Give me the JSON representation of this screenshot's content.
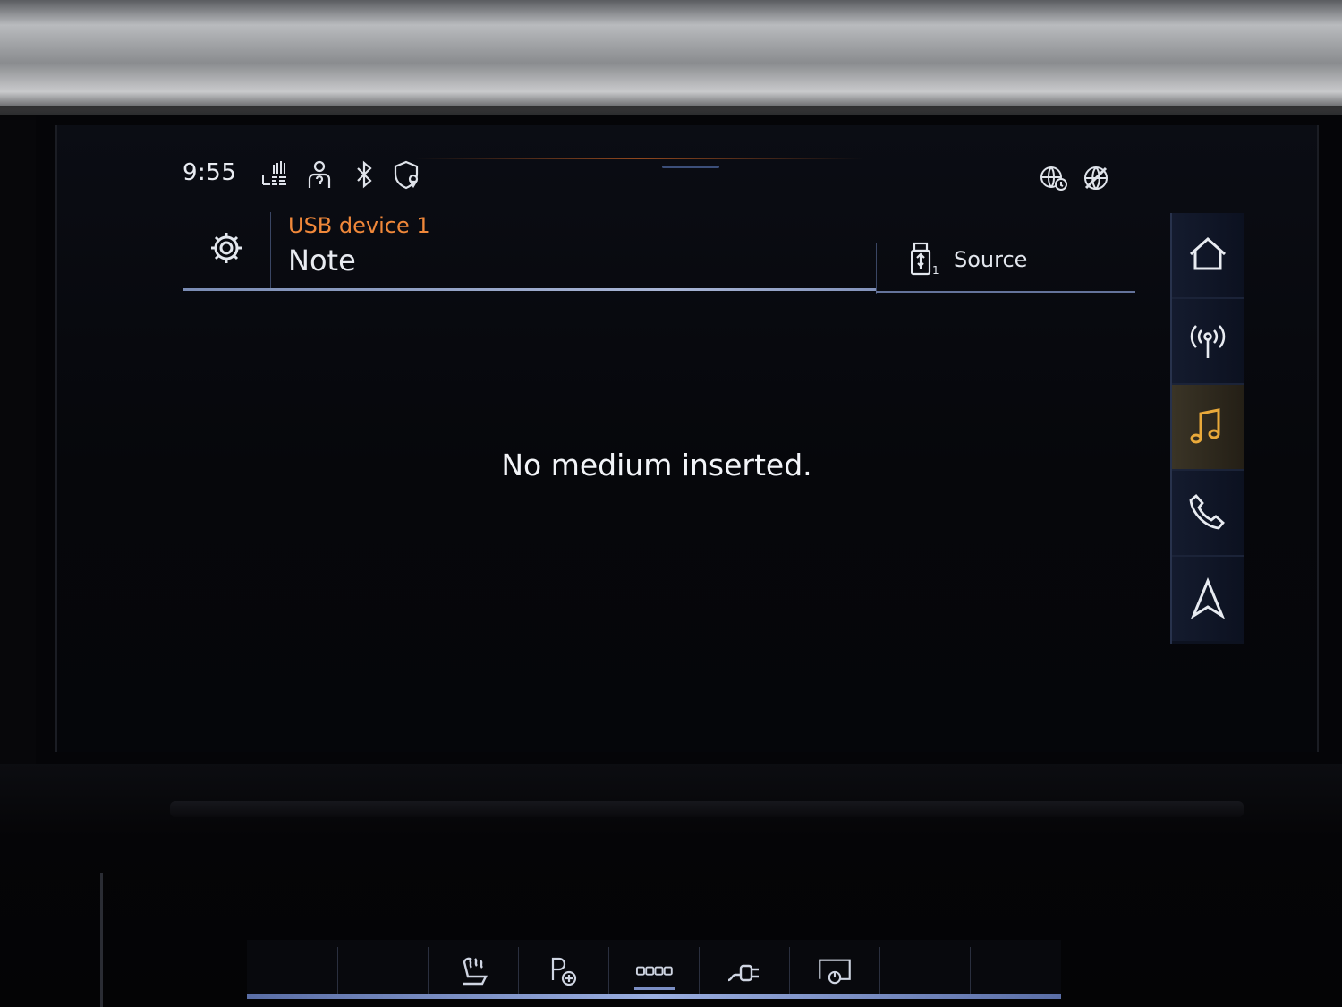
{
  "status_bar": {
    "time": "9:55",
    "icons": [
      "lte-signal-icon",
      "driver-profile-icon",
      "bluetooth-icon",
      "privacy-location-icon",
      "online-services-icon",
      "online-services-2-icon"
    ]
  },
  "header": {
    "source_label": "USB device 1",
    "track_title": "Note",
    "source_button_label": "Source",
    "usb_index": "1"
  },
  "main": {
    "message": "No medium inserted."
  },
  "dock": {
    "items": [
      {
        "icon": "home-icon",
        "active": false
      },
      {
        "icon": "radio-icon",
        "active": false
      },
      {
        "icon": "music-icon",
        "active": true
      },
      {
        "icon": "phone-icon",
        "active": false
      },
      {
        "icon": "navigation-icon",
        "active": false
      }
    ]
  },
  "climate_bar": {
    "items": [
      "blank-1",
      "blank-2",
      "seat-heating-icon",
      "parking-icon",
      "hazard-keypad-icon",
      "charging-icon",
      "display-power-icon",
      "blank-3",
      "blank-4"
    ]
  },
  "colors": {
    "accent_orange": "#f0883a",
    "active_amber": "#e9a93a",
    "underline_blue": "#a9b6d6"
  }
}
